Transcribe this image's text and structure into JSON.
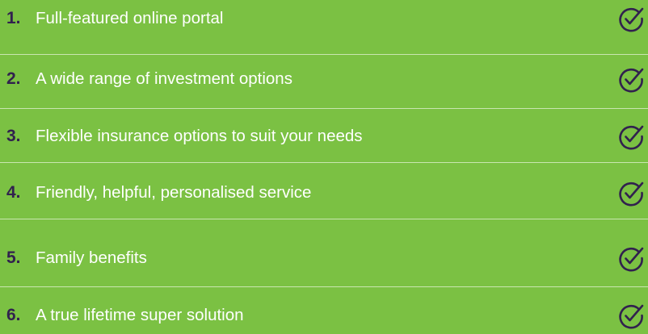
{
  "colors": {
    "background": "#7bc143",
    "number": "#31214e",
    "text": "#ffffff",
    "divider": "#c9e6b0",
    "check_icon": "#31214e"
  },
  "items": [
    {
      "number": "1.",
      "label": "Full-featured online portal",
      "icon": "check-circle-icon"
    },
    {
      "number": "2.",
      "label": "A wide range of investment options",
      "icon": "check-circle-icon"
    },
    {
      "number": "3.",
      "label": "Flexible insurance options to suit your needs",
      "icon": "check-circle-icon"
    },
    {
      "number": "4.",
      "label": "Friendly, helpful, personalised service",
      "icon": "check-circle-icon"
    },
    {
      "number": "5.",
      "label": "Family benefits",
      "icon": "check-circle-icon"
    },
    {
      "number": "6.",
      "label": "A true lifetime super solution",
      "icon": "check-circle-icon"
    }
  ]
}
